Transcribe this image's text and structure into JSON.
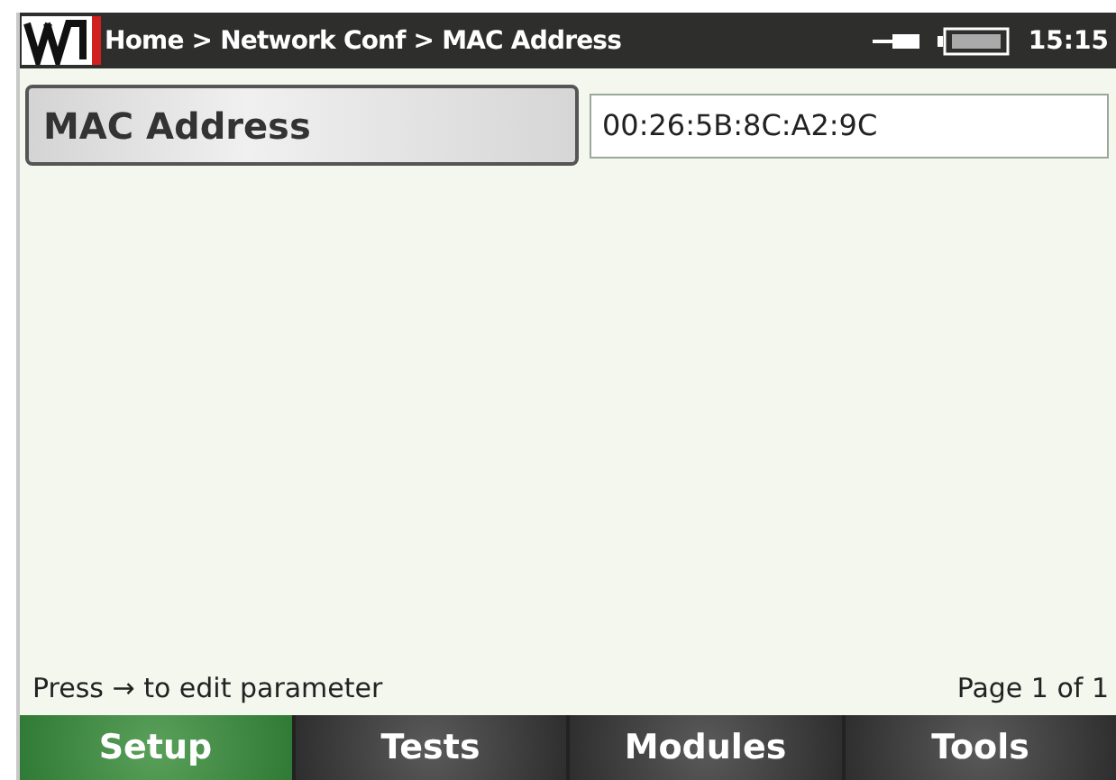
{
  "header": {
    "breadcrumb": "Home > Network Conf > MAC Address",
    "time": "15:15"
  },
  "parameter": {
    "label": "MAC Address",
    "value": "00:26:5B:8C:A2:9C"
  },
  "footer": {
    "hint": "Press → to edit parameter",
    "page": "Page 1 of 1"
  },
  "tabs": [
    {
      "label": "Setup",
      "selected": true
    },
    {
      "label": "Tests",
      "selected": false
    },
    {
      "label": "Modules",
      "selected": false
    },
    {
      "label": "Tools",
      "selected": false
    }
  ]
}
